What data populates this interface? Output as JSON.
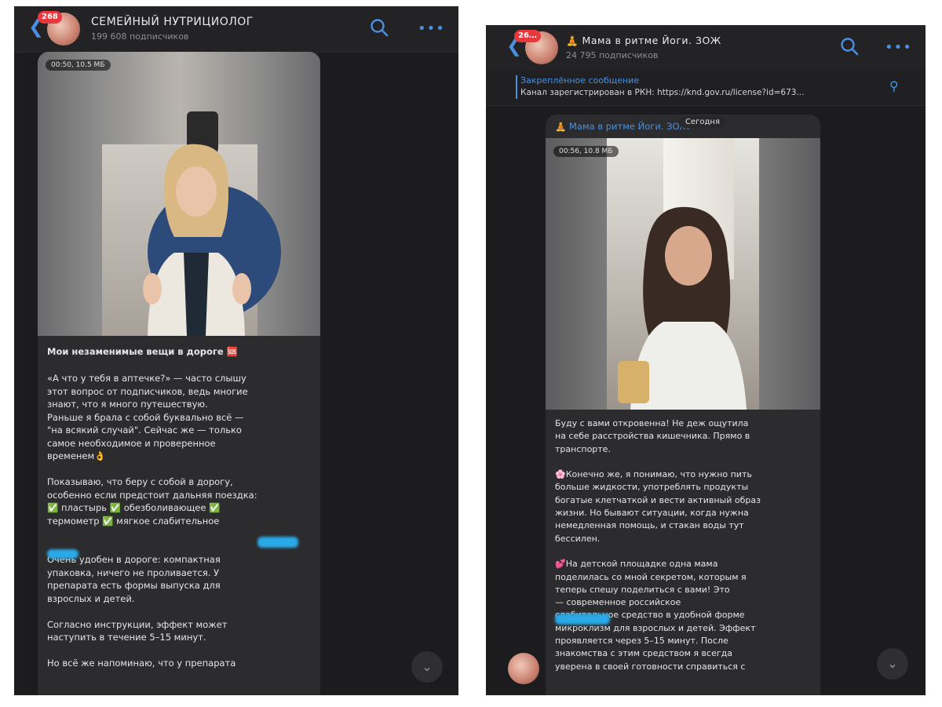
{
  "left": {
    "badge": "268",
    "channel_title": "СЕМЕЙНЫЙ НУТРИЦИОЛОГ",
    "subscribers": "199 608 подписчиков",
    "video_stamp": "00:50, 10.5 МБ",
    "heading": "Мои незаменимые вещи в дороге 🆘",
    "body": "«А что у тебя в аптечке?» — часто слышу\nэтот вопрос от подписчиков, ведь многие\nзнают, что я много путешествую.\nРаньше я брала с собой буквально всё —\n\"на всякий случай\". Сейчас же — только\nсамое необходимое и проверенное\nвременем👌\n\nПоказываю, что беру с собой в дорогу,\nособенно если предстоит дальняя поездка:\n✅ пластырь ✅ обезболивающее ✅\nтермометр ✅ мягкое слабительное\n\n\nОчень удобен в дороге: компактная\nупаковка, ничего не проливается. У\nпрепарата есть формы выпуска для\nвзрослых и детей.\n\nСогласно инструкции, эффект может\nнаступить в течение 5–15 минут.\n\nНо всё же напоминаю, что у препарата"
  },
  "right": {
    "badge": "26…",
    "channel_title": "🧘 Мама в ритме Йоги. ЗОЖ",
    "subscribers": "24 795 подписчиков",
    "pinned_title": "Закреплённое сообщение",
    "pinned_text": "Канал зарегистрирован в РКН: https://knd.gov.ru/license?id=673...",
    "date_badge": "Сегодня",
    "author": "🧘 Мама в ритме Йоги. ЗОЖ",
    "video_stamp": "00:56, 10.8 МБ",
    "body": "Буду с вами откровенна! Не деж ощутила\nна себе расстройства кишечника. Прямо в\nтранспорте.\n\n🌸Конечно же, я понимаю, что нужно пить\nбольше жидкости, употреблять продукты\nбогатые клетчаткой и вести активный образ\nжизни. Но бывают ситуации, когда нужна\nнемедленная помощь, и стакан воды тут\nбессилен.\n\n💕На детской площадке одна мама\nподелилась со мной секретом, которым я\nтеперь спешу поделиться с вами! Это\n              — современное российское\nслабительное средство в удобной форме\nмикроклизм для взрослых и детей. Эффект\nпроявляется через 5–15 минут. После\nзнакомства с этим средством я всегда\nуверена в своей готовности справиться с"
  },
  "colors": {
    "accent": "#4a90e2",
    "badge": "#e8383d",
    "background": "#1c1c1e"
  }
}
